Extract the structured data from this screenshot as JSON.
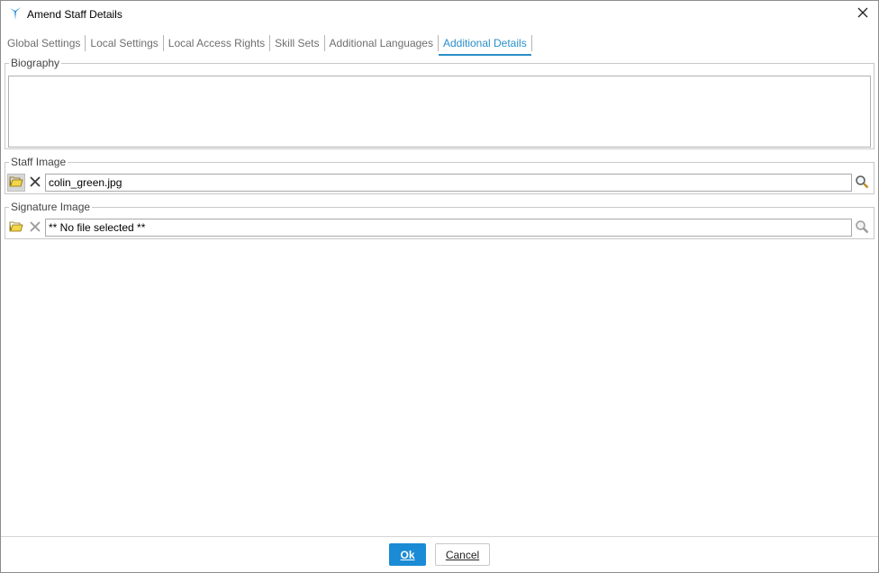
{
  "window": {
    "title": "Amend Staff Details",
    "accent_color": "#2a8fc9"
  },
  "tabs": [
    {
      "label": "Global Settings",
      "active": false
    },
    {
      "label": "Local Settings",
      "active": false
    },
    {
      "label": "Local Access Rights",
      "active": false
    },
    {
      "label": "Skill Sets",
      "active": false
    },
    {
      "label": "Additional Languages",
      "active": false
    },
    {
      "label": "Additional Details",
      "active": true
    }
  ],
  "biography": {
    "legend": "Biography",
    "value": ""
  },
  "staff_image": {
    "legend": "Staff Image",
    "file": "colin_green.jpg",
    "icons": [
      "open-folder-icon",
      "clear-x-icon",
      "search-icon"
    ]
  },
  "signature_image": {
    "legend": "Signature Image",
    "file": "** No file selected **",
    "icons": [
      "open-folder-icon",
      "clear-x-icon",
      "search-icon"
    ]
  },
  "footer": {
    "ok_label": "Ok",
    "cancel_label": "Cancel",
    "ok_color": "#1a8bd4"
  }
}
